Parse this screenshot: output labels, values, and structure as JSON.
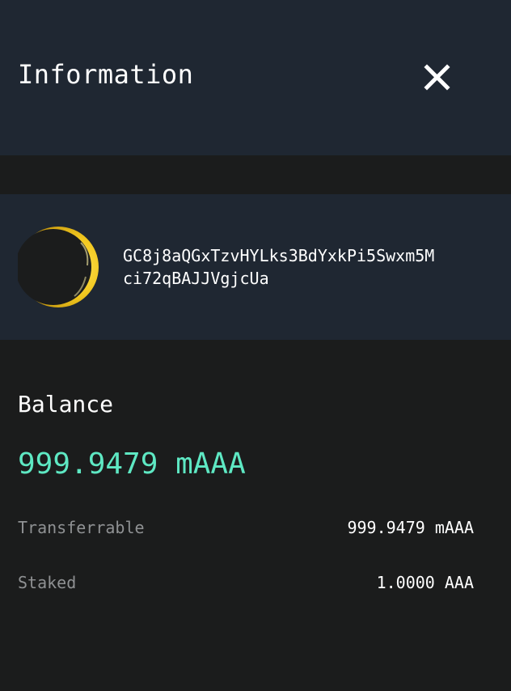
{
  "header": {
    "title": "Information",
    "close_icon": "close-icon"
  },
  "account": {
    "avatar_icon": "identicon-crescent",
    "address_line_1": "GC8j8aQGxTzvHYLks3BdYxkPi5Swxm5M",
    "address_line_2": "ci72qBAJJVgjcUa"
  },
  "balance": {
    "label": "Balance",
    "total": "999.9479 mAAA",
    "rows": [
      {
        "label": "Transferrable",
        "value": "999.9479 mAAA"
      },
      {
        "label": "Staked",
        "value": "1.0000 AAA"
      }
    ]
  },
  "colors": {
    "header_bg": "#1f2732",
    "page_bg": "#1b1c1c",
    "accent": "#5ee8c3",
    "muted_text": "#8f9193",
    "avatar_gold": "#f2c81f"
  }
}
